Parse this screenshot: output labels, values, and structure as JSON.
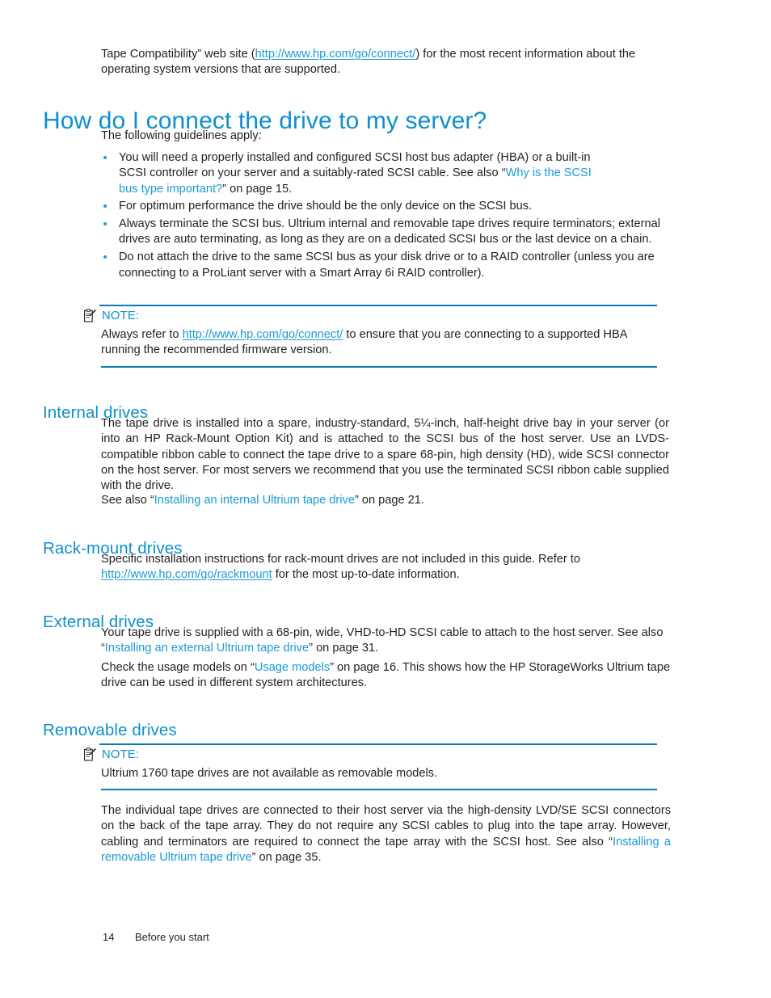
{
  "colors": {
    "heading": "#0e90cf",
    "link": "#1b9ad6",
    "rule": "#0b7bb5",
    "body": "#231f20"
  },
  "intro": {
    "line1_before": "Tape Compatibility” web site (",
    "link_text": "http://www.hp.com/go/connect/",
    "line1_after": ") for the most recent information about",
    "line2": "the operating system versions that are supported."
  },
  "title": "How do I connect the drive to my server?",
  "lead": "The following guidelines apply:",
  "bullets": [
    {
      "part1": "You will need a properly installed and configured SCSI host bus adapter (HBA) or a built-in SCSI controller on your server and a suitably-rated SCSI cable.  See also “",
      "link": "Why is the SCSI bus type important?",
      "part2": "” on page 15."
    },
    {
      "part1": "For optimum performance the drive should be the only device on the SCSI bus.",
      "link": "",
      "part2": ""
    },
    {
      "part1": "Always terminate the SCSI bus.  Ultrium internal and removable tape drives require terminators; external drives are auto terminating, as long as they are on a dedicated SCSI bus or the last device on a chain.",
      "link": "",
      "part2": ""
    },
    {
      "part1": "Do not attach the drive to the same SCSI bus as your disk drive or to a RAID controller (unless you are connecting to a ProLiant server with a Smart Array 6i RAID controller).",
      "link": "",
      "part2": ""
    }
  ],
  "note1": {
    "icon": "note-clipboard-icon",
    "label": "NOTE:",
    "body_before": "Always refer to ",
    "body_link": "http://www.hp.com/go/connect/",
    "body_after": " to ensure that you are connecting to a supported HBA running the recommended firmware version."
  },
  "sections": {
    "internal": {
      "heading": "Internal drives",
      "para1": "The tape drive is installed into a spare, industry-standard, 5¼-inch, half-height drive bay in your server (or into an HP Rack-Mount Option Kit) and is attached to the SCSI bus of the host server.  Use an LVDS-compatible ribbon cable to connect the tape drive to a spare 68-pin, high density (HD), wide SCSI connector on the host server.  For most servers we recommend that you use the terminated SCSI ribbon cable supplied with the drive.",
      "para2_before": "See also “",
      "para2_link": "Installing an internal Ultrium tape drive",
      "para2_after": "” on page 21."
    },
    "rackmount": {
      "heading": "Rack-mount drives",
      "para_before": "Specific installation instructions for rack-mount drives are not included in this guide.  Refer to ",
      "para_link": "http://www.hp.com/go/rackmount",
      "para_after": " for the most up-to-date information."
    },
    "external": {
      "heading": "External drives",
      "para1_before": "Your tape drive is supplied with a 68-pin, wide, VHD-to-HD SCSI cable to attach to the host server.  See also “",
      "para1_link": "Installing an external Ultrium tape drive",
      "para1_after": "” on page 31.",
      "para2_before": "Check the usage models on “",
      "para2_link": "Usage models",
      "para2_after": "” on page 16.  This shows how the HP StorageWorks Ultrium tape drive can be used in different system architectures."
    },
    "removable": {
      "heading": "Removable drives",
      "note": {
        "icon": "note-clipboard-icon",
        "label": "NOTE:",
        "body": "Ultrium 1760 tape drives are not available as removable models."
      },
      "para_before": "The individual tape drives are connected to their host server via the high-density LVD/SE SCSI connectors on the back of the tape array.  They do not require any SCSI cables to plug into the tape array.  However, cabling and terminators are required to connect the tape array with the SCSI host.  See also “",
      "para_link": "Installing a removable Ultrium tape drive",
      "para_after": "” on page 35."
    }
  },
  "footer": {
    "page_number": "14",
    "chapter": "Before you start"
  }
}
